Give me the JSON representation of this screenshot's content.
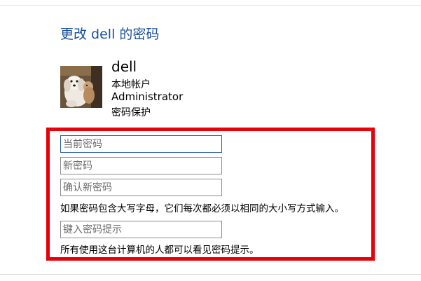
{
  "title": "更改 dell 的密码",
  "user": {
    "name": "dell",
    "account_type": "本地帐户",
    "role": "Administrator",
    "protection": "密码保护"
  },
  "form": {
    "current_password_placeholder": "当前密码",
    "new_password_placeholder": "新密码",
    "confirm_password_placeholder": "确认新密码",
    "case_note": "如果密码包含大写字母，它们每次都必须以相同的大小写方式输入。",
    "hint_placeholder": "键入密码提示",
    "hint_note": "所有使用这台计算机的人都可以看见密码提示。"
  },
  "colors": {
    "title": "#1a4f9c",
    "highlight_border": "#e8000b",
    "focused_border": "#2b5ea7"
  },
  "icons": {
    "avatar": "user-photo-dog"
  }
}
